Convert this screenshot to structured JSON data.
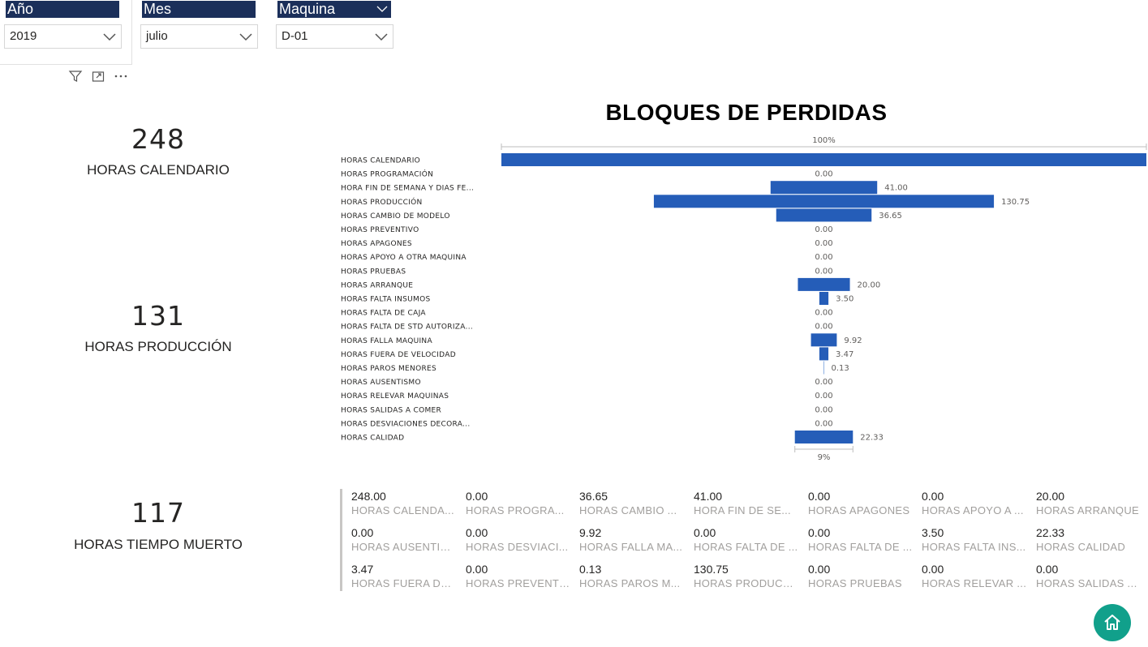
{
  "slicers": [
    {
      "header": "Año",
      "value": "2019"
    },
    {
      "header": "Mes",
      "value": "julio"
    },
    {
      "header": "Maquina",
      "value": "D-01"
    }
  ],
  "toolbar": {
    "filter_icon": "filter-icon",
    "focus_icon": "focus-mode-icon",
    "more_icon": "more-options-icon"
  },
  "cards": [
    {
      "value": "248",
      "label": "HORAS CALENDARIO"
    },
    {
      "value": "131",
      "label": "HORAS PRODUCCIÓN"
    },
    {
      "value": "117",
      "label": "HORAS TIEMPO MUERTO"
    }
  ],
  "chart_data": {
    "type": "bar",
    "title": "BLOQUES DE PERDIDAS",
    "top_percent_label": "100%",
    "bottom_percent_label": "9%",
    "bar_color": "#255db8",
    "categories": [
      "HORAS CALENDARIO",
      "HORAS PROGRAMACIÓN",
      "HORA FIN DE SEMANA Y DIAS FE...",
      "HORAS PRODUCCIÓN",
      "HORAS CAMBIO DE MODELO",
      "HORAS PREVENTIVO",
      "HORAS APAGONES",
      "HORAS APOYO A OTRA MAQUINA",
      "HORAS PRUEBAS",
      "HORAS ARRANQUE",
      "HORAS FALTA INSUMOS",
      "HORAS FALTA DE CAJA",
      "HORAS FALTA DE STD AUTORIZA...",
      "HORAS FALLA MAQUINA",
      "HORAS FUERA DE VELOCIDAD",
      "HORAS PAROS MENORES",
      "HORAS AUSENTISMO",
      "HORAS RELEVAR MAQUINAS",
      "HORAS SALIDAS A COMER",
      "HORAS DESVIACIONES DECORA...",
      "HORAS CALIDAD"
    ],
    "values": [
      248,
      0,
      41,
      130.75,
      36.65,
      0,
      0,
      0,
      0,
      20,
      3.5,
      0,
      0,
      9.92,
      3.47,
      0.13,
      0,
      0,
      0,
      0,
      22.33
    ],
    "data_labels": [
      "",
      "0.00",
      "41.00",
      "130.75",
      "36.65",
      "0.00",
      "0.00",
      "0.00",
      "0.00",
      "20.00",
      "3.50",
      "0.00",
      "0.00",
      "9.92",
      "3.47",
      "0.13",
      "0.00",
      "0.00",
      "0.00",
      "0.00",
      "22.33"
    ]
  },
  "multirow": [
    {
      "value": "248.00",
      "label": "HORAS CALENDA..."
    },
    {
      "value": "0.00",
      "label": "HORAS PROGRA..."
    },
    {
      "value": "36.65",
      "label": "HORAS CAMBIO ..."
    },
    {
      "value": "41.00",
      "label": "HORA FIN DE SE..."
    },
    {
      "value": "0.00",
      "label": "HORAS APAGONES"
    },
    {
      "value": "0.00",
      "label": "HORAS APOYO A ..."
    },
    {
      "value": "20.00",
      "label": "HORAS ARRANQUE"
    },
    {
      "value": "0.00",
      "label": "HORAS AUSENTIS..."
    },
    {
      "value": "0.00",
      "label": "HORAS DESVIACI..."
    },
    {
      "value": "9.92",
      "label": "HORAS FALLA MA..."
    },
    {
      "value": "0.00",
      "label": "HORAS FALTA DE ..."
    },
    {
      "value": "0.00",
      "label": "HORAS FALTA DE ..."
    },
    {
      "value": "3.50",
      "label": "HORAS FALTA INS..."
    },
    {
      "value": "22.33",
      "label": "HORAS CALIDAD"
    },
    {
      "value": "3.47",
      "label": "HORAS FUERA DE..."
    },
    {
      "value": "0.00",
      "label": "HORAS PREVENTI..."
    },
    {
      "value": "0.13",
      "label": "HORAS PAROS M..."
    },
    {
      "value": "130.75",
      "label": "HORAS PRODUCC..."
    },
    {
      "value": "0.00",
      "label": "HORAS PRUEBAS"
    },
    {
      "value": "0.00",
      "label": "HORAS RELEVAR ..."
    },
    {
      "value": "0.00",
      "label": "HORAS SALIDAS A C..."
    }
  ],
  "home_button": {
    "icon": "home-icon",
    "color": "#11a08b"
  }
}
